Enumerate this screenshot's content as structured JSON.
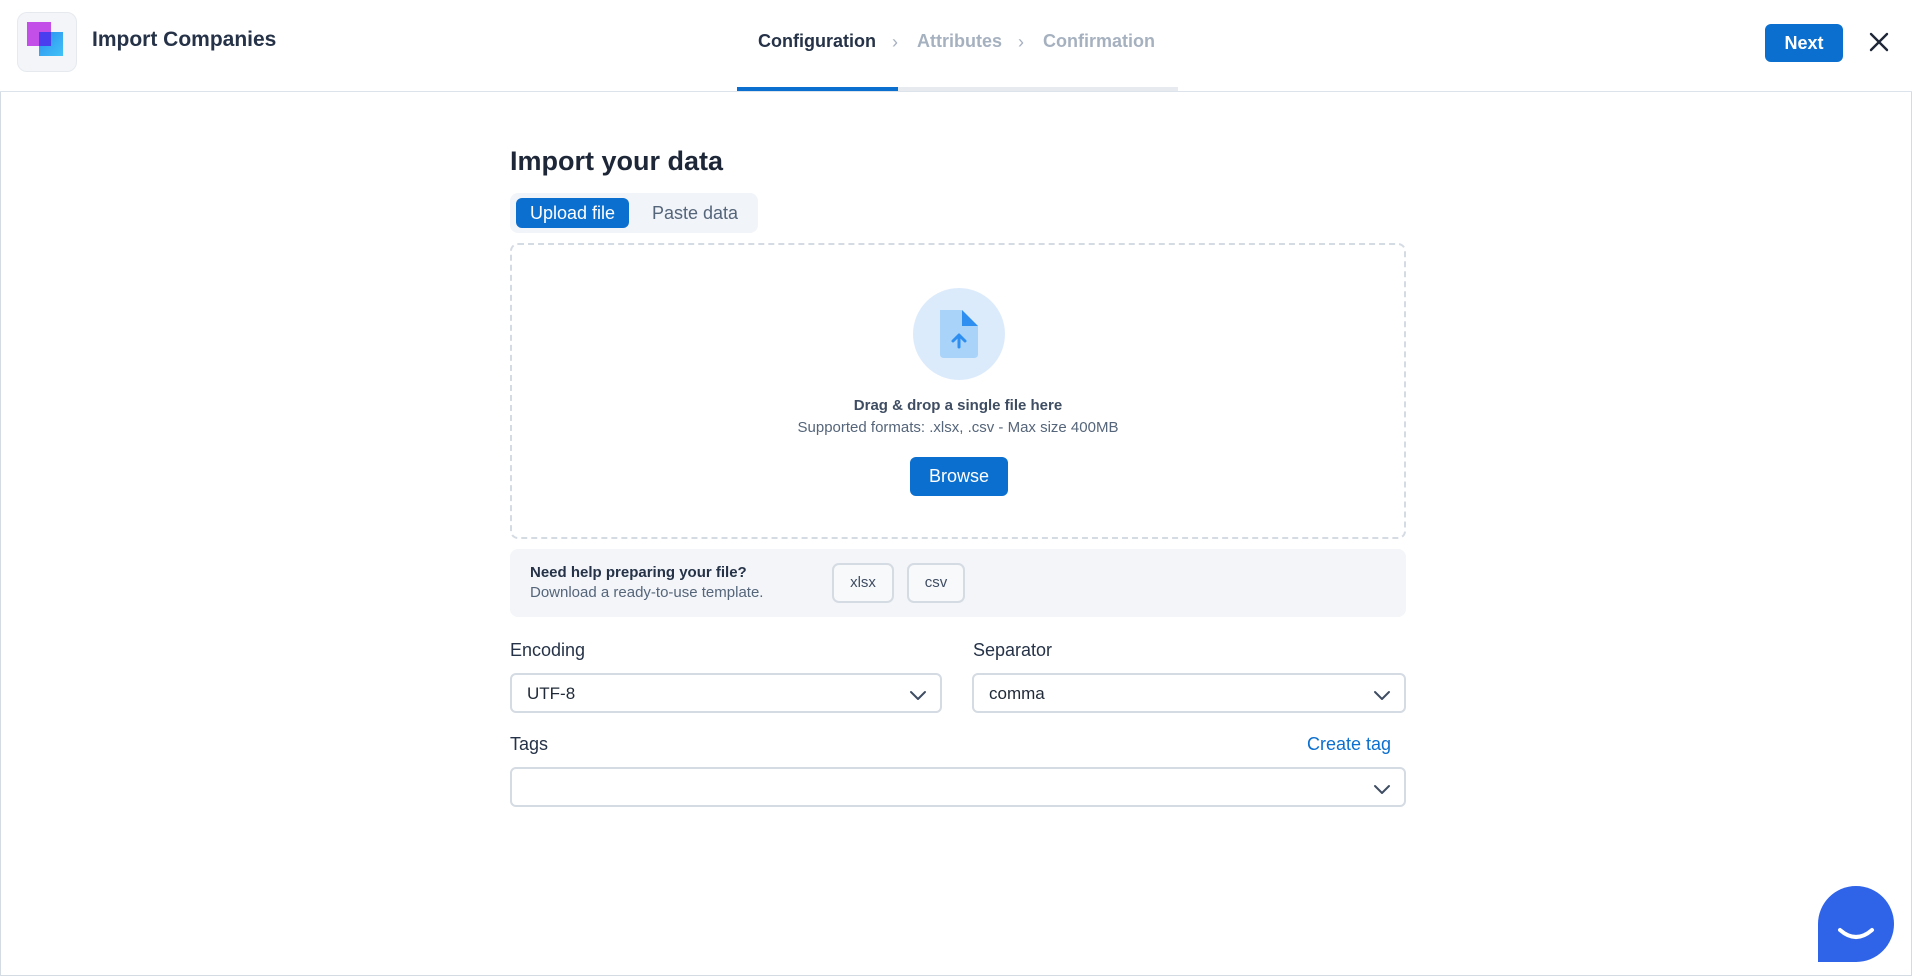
{
  "header": {
    "title": "Import Companies",
    "steps": [
      {
        "label": "Configuration",
        "state": "active"
      },
      {
        "label": "Attributes",
        "state": "pending"
      },
      {
        "label": "Confirmation",
        "state": "pending"
      }
    ],
    "next_label": "Next"
  },
  "main": {
    "title": "Import your data",
    "tabs": [
      {
        "label": "Upload file",
        "selected": true
      },
      {
        "label": "Paste data",
        "selected": false
      }
    ],
    "dropzone": {
      "title": "Drag & drop a single file here",
      "subtitle": "Supported formats: .xlsx, .csv - Max size 400MB",
      "browse_label": "Browse"
    },
    "help": {
      "title": "Need help preparing your file?",
      "subtitle": "Download a ready-to-use template.",
      "templates": [
        "xlsx",
        "csv"
      ]
    },
    "encoding": {
      "label": "Encoding",
      "value": "UTF-8"
    },
    "separator": {
      "label": "Separator",
      "value": "comma"
    },
    "tags": {
      "label": "Tags",
      "create_label": "Create tag",
      "value": ""
    }
  },
  "colors": {
    "accent": "#0b6fcf",
    "chat": "#2f63e8"
  },
  "icons": [
    "logo-icon",
    "chevron-right-icon",
    "close-icon",
    "file-upload-icon",
    "chevron-down-icon",
    "chat-icon"
  ]
}
